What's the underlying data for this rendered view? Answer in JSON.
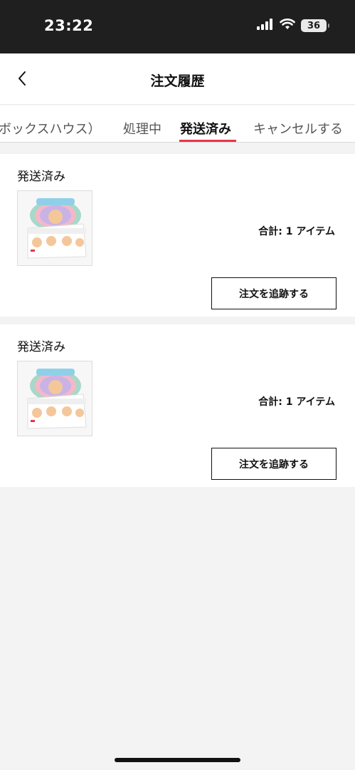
{
  "status_bar": {
    "time": "23:22",
    "battery": "36"
  },
  "header": {
    "title": "注文履歴"
  },
  "tabs": [
    {
      "label": "ボックスハウス）",
      "active": false
    },
    {
      "label": "処理中",
      "active": false
    },
    {
      "label": "発送済み",
      "active": true
    },
    {
      "label": "キャンセルする",
      "active": false
    }
  ],
  "orders": [
    {
      "status": "発送済み",
      "total": "合計: 1 アイテム",
      "track_label": "注文を追跡する"
    },
    {
      "status": "発送済み",
      "total": "合計: 1 アイテム",
      "track_label": "注文を追跡する"
    }
  ],
  "colors": {
    "accent": "#e8354a",
    "status_bar": "#1f1f1f"
  }
}
